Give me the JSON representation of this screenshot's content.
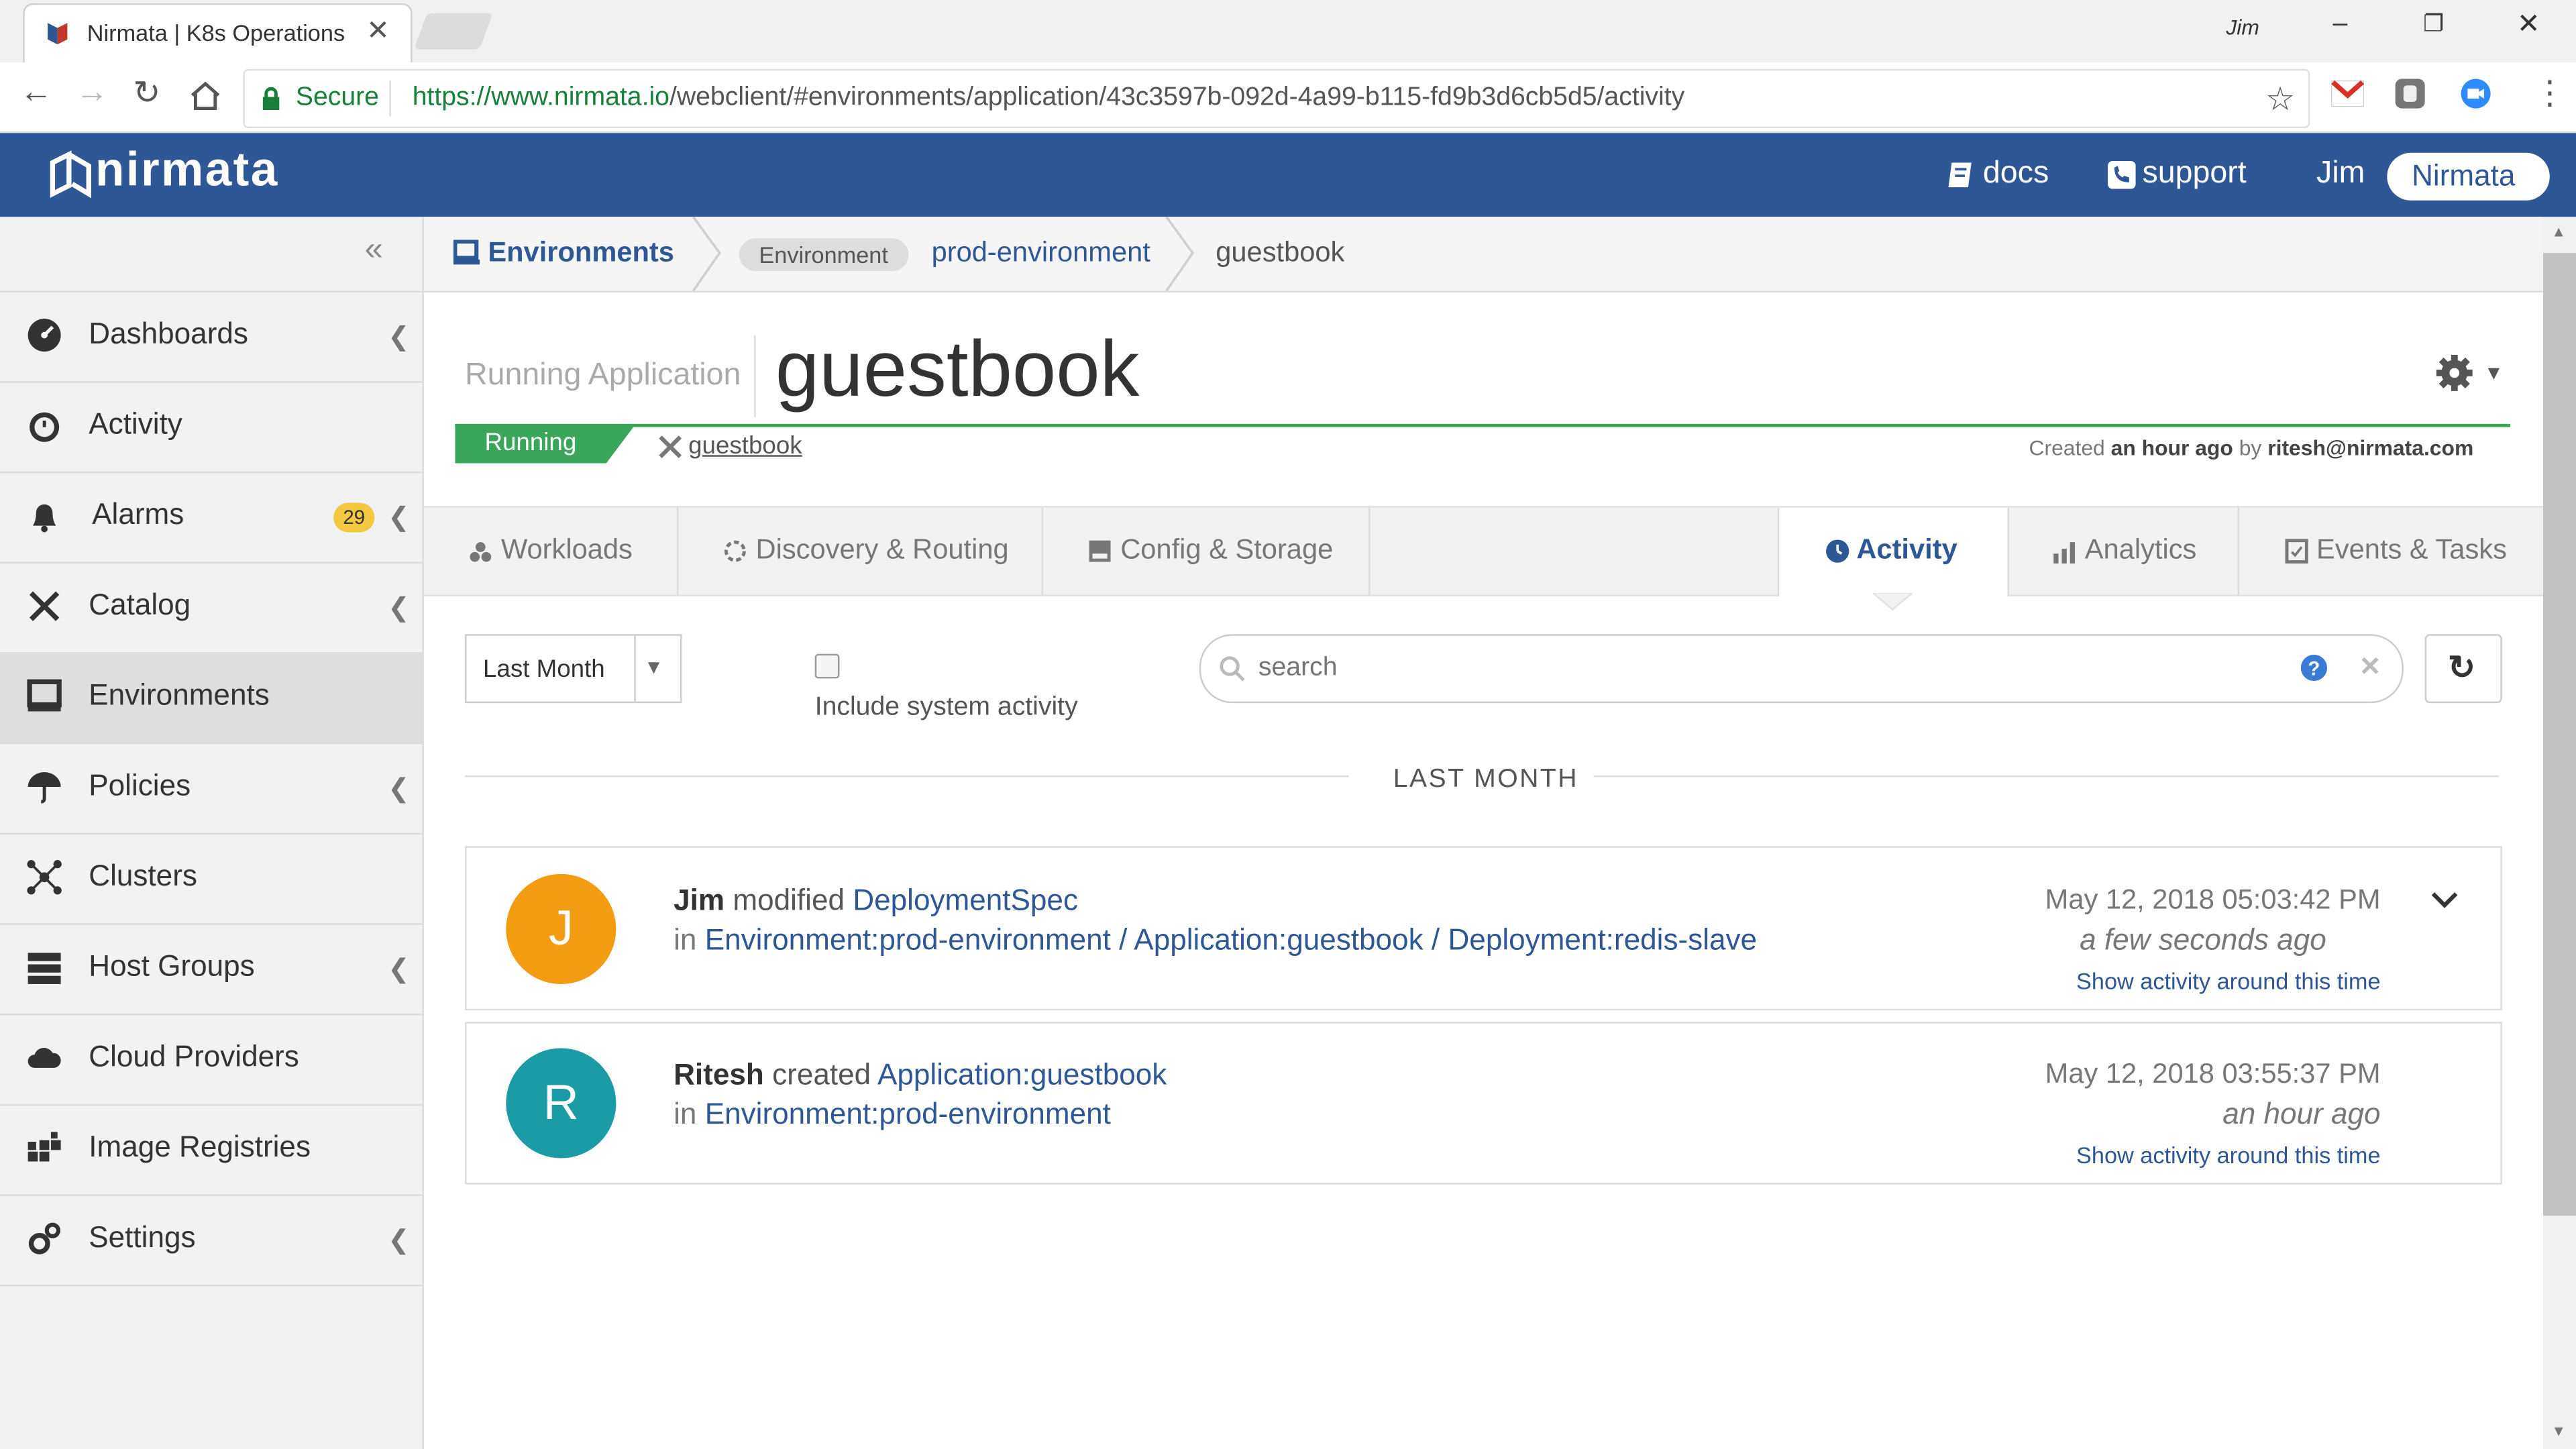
{
  "browser": {
    "tab_title": "Nirmata | K8s Operations",
    "window_user": "Jim",
    "secure_label": "Secure",
    "url_scheme_host": "https://www.nirmata.io",
    "url_path": "/webclient/#environments/application/43c3597b-092d-4a99-b115-fd9b3d6cb5d5/activity"
  },
  "header": {
    "brand": "nirmata",
    "docs": "docs",
    "support": "support",
    "user": "Jim",
    "org": "Nirmata"
  },
  "sidebar": {
    "items": [
      {
        "label": "Dashboards"
      },
      {
        "label": "Activity"
      },
      {
        "label": "Alarms",
        "badge": "29"
      },
      {
        "label": "Catalog"
      },
      {
        "label": "Environments"
      },
      {
        "label": "Policies"
      },
      {
        "label": "Clusters"
      },
      {
        "label": "Host Groups"
      },
      {
        "label": "Cloud Providers"
      },
      {
        "label": "Image Registries"
      },
      {
        "label": "Settings"
      }
    ]
  },
  "breadcrumb": {
    "root": "Environments",
    "env_tag": "Environment",
    "env_name": "prod-environment",
    "current": "guestbook"
  },
  "app": {
    "kind": "Running Application",
    "name": "guestbook",
    "status": "Running",
    "catalog_link": "guestbook",
    "created_prefix": "Created",
    "created_when": "an hour ago",
    "created_by_prefix": "by",
    "created_by": "ritesh@nirmata.com"
  },
  "tabs": {
    "workloads": "Workloads",
    "discovery": "Discovery & Routing",
    "config": "Config & Storage",
    "activity": "Activity",
    "analytics": "Analytics",
    "events": "Events & Tasks"
  },
  "filters": {
    "range": "Last Month",
    "include_system": "Include system activity",
    "search_placeholder": "search",
    "section": "LAST MONTH"
  },
  "activities": [
    {
      "initial": "J",
      "actor": "Jim",
      "verb": "modified",
      "object": "DeploymentSpec",
      "in": "in",
      "path1": "Environment:prod-environment",
      "sep1": "/",
      "path2": "Application:guestbook",
      "sep2": "/",
      "path3": "Deployment:redis-slave",
      "timestamp": "May 12, 2018 05:03:42 PM",
      "relative": "a few seconds ago",
      "around": "Show activity around this time"
    },
    {
      "initial": "R",
      "actor": "Ritesh",
      "verb": "created",
      "object": "Application:guestbook",
      "in": "in",
      "path1": "Environment:prod-environment",
      "timestamp": "May 12, 2018 03:55:37 PM",
      "relative": "an hour ago",
      "around": "Show activity around this time"
    }
  ],
  "colors": {
    "brand_blue": "#2e5795",
    "running_green": "#3aa65a",
    "avatar_orange": "#f39c12",
    "avatar_teal": "#1a9ba6",
    "badge_yellow": "#f5c842"
  }
}
